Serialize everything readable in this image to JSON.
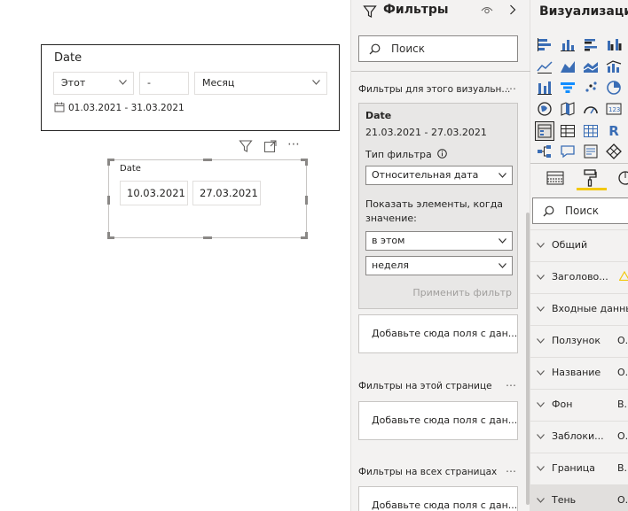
{
  "slicer_month": {
    "title": "Date",
    "mode": "Этот",
    "count": "-",
    "unit": "Месяц",
    "range": "01.03.2021 - 31.03.2021"
  },
  "slicer_between": {
    "title": "Date",
    "start": "10.03.2021",
    "end": "27.03.2021"
  },
  "filters_pane": {
    "title": "Фильтры",
    "search_placeholder": "Поиск",
    "visual_section": "Фильтры для этого визуальн...",
    "card": {
      "field": "Date",
      "value": "21.03.2021 - 27.03.2021",
      "filter_type_label": "Тип фильтра",
      "filter_type": "Относительная дата",
      "show_items_label_1": "Показать элементы, когда",
      "show_items_label_2": "значение:",
      "condition": "в этом",
      "period": "неделя",
      "apply": "Применить фильтр"
    },
    "add_fields": "Добавьте сюда поля с дан...",
    "page_section": "Фильтры на этой странице",
    "all_pages_section": "Фильтры на всех страницах"
  },
  "viz_pane": {
    "title": "Визуализации",
    "search_placeholder": "Поиск",
    "format_rows": [
      {
        "label": "Общий",
        "value": ""
      },
      {
        "label": "Заголово...",
        "value": ""
      },
      {
        "label": "Входные данные",
        "value": ""
      },
      {
        "label": "Ползунок",
        "value": "О."
      },
      {
        "label": "Название",
        "value": "О."
      },
      {
        "label": "Фон",
        "value": "В."
      },
      {
        "label": "Заблоки...",
        "value": "О."
      },
      {
        "label": "Граница",
        "value": "В."
      },
      {
        "label": "Тень",
        "value": "О."
      }
    ]
  },
  "colors": {
    "accent": "#f2c811",
    "pane_bg": "#f3f2f1",
    "text": "#252423"
  }
}
